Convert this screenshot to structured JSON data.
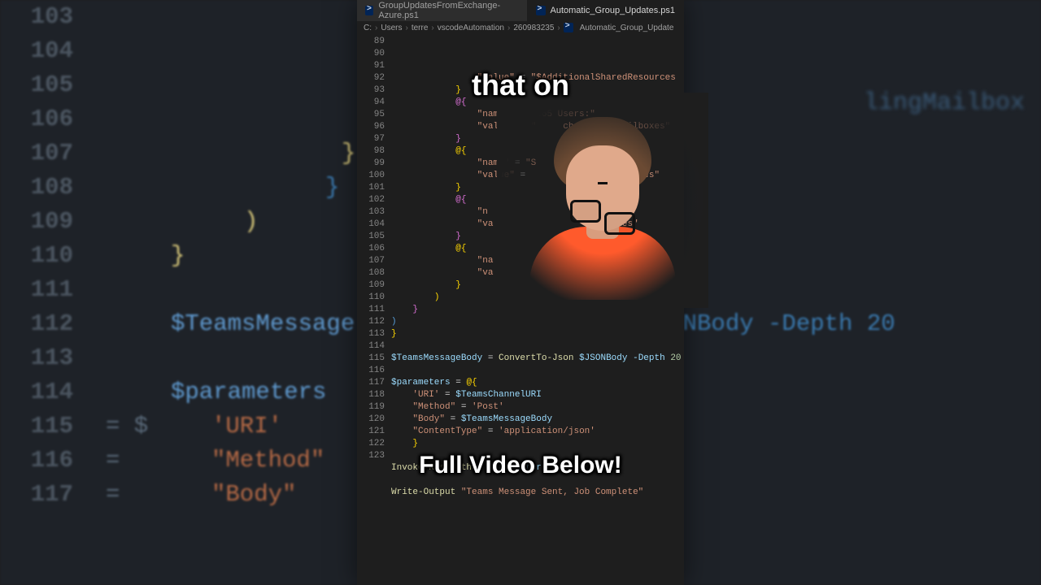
{
  "bg_lines": [
    {
      "num": "103",
      "tokens": []
    },
    {
      "num": "104",
      "tokens": []
    },
    {
      "num": "105",
      "tokens": []
    },
    {
      "num": "106",
      "tokens": []
    },
    {
      "num": "107",
      "tokens": [
        {
          "t": "}",
          "cls": "y",
          "pad": 290
        }
      ]
    },
    {
      "num": "108",
      "tokens": [
        {
          "t": "}",
          "cls": "b",
          "pad": 270
        }
      ]
    },
    {
      "num": "109",
      "tokens": [
        {
          "t": ")",
          "cls": "y",
          "pad": 170
        }
      ]
    },
    {
      "num": "110",
      "tokens": [
        {
          "t": "}",
          "cls": "y",
          "pad": 80
        }
      ]
    },
    {
      "num": "111",
      "tokens": []
    },
    {
      "num": "112",
      "tokens": [
        {
          "t": "$TeamsMessage",
          "cls": "k",
          "pad": 80
        },
        {
          "t": "  $JSONBody -Depth 20",
          "cls": "b",
          "pad": 640
        }
      ]
    },
    {
      "num": "113",
      "tokens": []
    },
    {
      "num": "114",
      "tokens": [
        {
          "t": "$parameters",
          "cls": "k",
          "pad": 80
        }
      ]
    },
    {
      "num": "115",
      "tokens": [
        {
          "t": "'URI'",
          "cls": "s",
          "pad": 130
        },
        {
          "t": " = $",
          "cls": "",
          "pad": 0
        }
      ]
    },
    {
      "num": "116",
      "tokens": [
        {
          "t": "\"Method\"",
          "cls": "s",
          "pad": 130
        },
        {
          "t": " =",
          "cls": "",
          "pad": 0
        }
      ]
    },
    {
      "num": "117",
      "tokens": [
        {
          "t": "\"Body\"",
          "cls": "s",
          "pad": 130
        },
        {
          "t": " =",
          "cls": "",
          "pad": 0
        }
      ]
    }
  ],
  "bg_right": "lingMailbox",
  "tabs": [
    {
      "label": "GroupUpdatesFromExchange-Azure.ps1",
      "active": false
    },
    {
      "label": "Automatic_Group_Updates.ps1",
      "active": true
    }
  ],
  "breadcrumb": [
    "C:",
    "Users",
    "terre",
    "vscodeAutomation",
    "260983235",
    "Automatic_Group_Update"
  ],
  "code": [
    {
      "n": "89",
      "html": "                <span class='tok-str'>\"value\"</span> = <span class='tok-str'>\"$AdditionalSharedResources</span>"
    },
    {
      "n": "90",
      "html": "            <span class='tok-brc'>}</span>"
    },
    {
      "n": "91",
      "html": "            <span class='tok-brc2'>@{</span>"
    },
    {
      "n": "92",
      "html": "                <span class='tok-str'>\"name\"</span> = <span class='tok-str'>\"M365 Users:\"</span>"
    },
    {
      "n": "93",
      "html": "                <span class='tok-str'>\"value\"</span> = <span class='tok-str'>\"     changeUserMailboxes\"</span>"
    },
    {
      "n": "94",
      "html": "            <span class='tok-brc2'>}</span>"
    },
    {
      "n": "95",
      "html": "            <span class='tok-brc'>@{</span>"
    },
    {
      "n": "96",
      "html": "                <span class='tok-str'>\"name\"</span> = <span class='tok-str'>\"S        ilboxes:\"</span>"
    },
    {
      "n": "97",
      "html": "                <span class='tok-str'>\"value\"</span> =           <span class='tok-str'>aredMailboxes\"</span> "
    },
    {
      "n": "98",
      "html": "            <span class='tok-brc'>}</span>"
    },
    {
      "n": "99",
      "html": "            <span class='tok-brc2'>@{</span>"
    },
    {
      "n": "100",
      "html": "                <span class='tok-str'>\"n</span>"
    },
    {
      "n": "101",
      "html": "                <span class='tok-str'>\"va</span>                   <span class='tok-str'>ilboxes\"</span>"
    },
    {
      "n": "102",
      "html": "            <span class='tok-brc2'>}</span>"
    },
    {
      "n": "103",
      "html": "            <span class='tok-brc'>@{</span>"
    },
    {
      "n": "104",
      "html": "                <span class='tok-str'>\"na</span>                      <span class='tok-str'>s:\"</span>"
    },
    {
      "n": "105",
      "html": "                <span class='tok-str'>\"va</span>                   <span class='tok-str'>lingMailbox</span>"
    },
    {
      "n": "106",
      "html": "            <span class='tok-brc'>}</span>"
    },
    {
      "n": "107",
      "html": "        <span class='tok-brc'>)</span>"
    },
    {
      "n": "108",
      "html": "    <span class='tok-brc2'>}</span>"
    },
    {
      "n": "109",
      "html": "<span class='tok-brc3'>)</span>"
    },
    {
      "n": "110",
      "html": "<span class='tok-brc'>}</span>"
    },
    {
      "n": "111",
      "html": ""
    },
    {
      "n": "112",
      "html": "<span class='tok-var'>$TeamsMessageBody</span> = <span class='tok-cmd'>ConvertTo-Json</span> <span class='tok-var'>$JSONBody</span> <span class='tok-param'>-Depth</span> <span class='tok-num'>20</span>"
    },
    {
      "n": "113",
      "html": ""
    },
    {
      "n": "114",
      "html": "<span class='tok-var'>$parameters</span> = <span class='tok-brc'>@{</span>"
    },
    {
      "n": "115",
      "html": "    <span class='tok-str'>'URI'</span> = <span class='tok-var'>$TeamsChannelURI</span>"
    },
    {
      "n": "116",
      "html": "    <span class='tok-str'>\"Method\"</span> = <span class='tok-str'>'Post'</span>"
    },
    {
      "n": "117",
      "html": "    <span class='tok-str'>\"Body\"</span> = <span class='tok-var'>$TeamsMessageBody</span>"
    },
    {
      "n": "118",
      "html": "    <span class='tok-str'>\"ContentType\"</span> = <span class='tok-str'>'application/json'</span>"
    },
    {
      "n": "119",
      "html": "    <span class='tok-brc'>}</span>"
    },
    {
      "n": "120",
      "html": ""
    },
    {
      "n": "121",
      "html": "<span class='tok-cmd'>Invoke-RestMethod</span> <span class='tok-var'>@parameters</span>"
    },
    {
      "n": "122",
      "html": ""
    },
    {
      "n": "123",
      "html": "<span class='tok-cmd'>Write-Output</span> <span class='tok-str'>\"Teams Message Sent, Job Complete\"</span>"
    }
  ],
  "caption1": "that on",
  "caption2": "Full Video Below!"
}
